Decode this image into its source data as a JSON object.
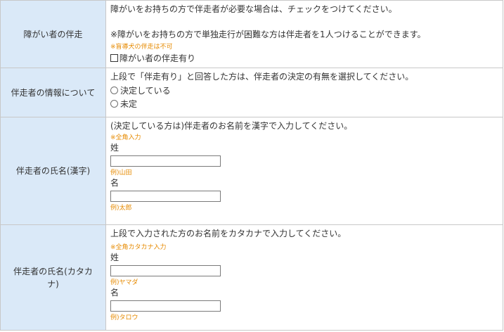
{
  "rows": [
    {
      "label": "障がい者の伴走",
      "instruction": "障がいをお持ちの方で伴走者が必要な場合は、チェックをつけてください。",
      "instruction2": "※障がいをお持ちの方で単独走行が困難な方は伴走者を1人つけることができます。",
      "note": "※盲導犬の伴走は不可",
      "checkbox_label": "障がい者の伴走有り"
    },
    {
      "label": "伴走者の情報について",
      "instruction": "上段で「伴走有り」と回答した方は、伴走者の決定の有無を選択してください。",
      "options": [
        "決定している",
        "未定"
      ]
    },
    {
      "label": "伴走者の氏名(漢字)",
      "instruction": "(決定している方は)伴走者のお名前を漢字で入力してください。",
      "note": "※全角入力",
      "last_label": "姓",
      "last_example": "例)山田",
      "first_label": "名",
      "first_example": "例)太郎"
    },
    {
      "label_line1": "伴走者の氏名(カタカ",
      "label_line2": "ナ)",
      "instruction": "上段で入力された方のお名前をカタカナで入力してください。",
      "note": "※全角カタカナ入力",
      "last_label": "姓",
      "last_example": "例)ヤマダ",
      "first_label": "名",
      "first_example": "例)タロウ"
    }
  ]
}
